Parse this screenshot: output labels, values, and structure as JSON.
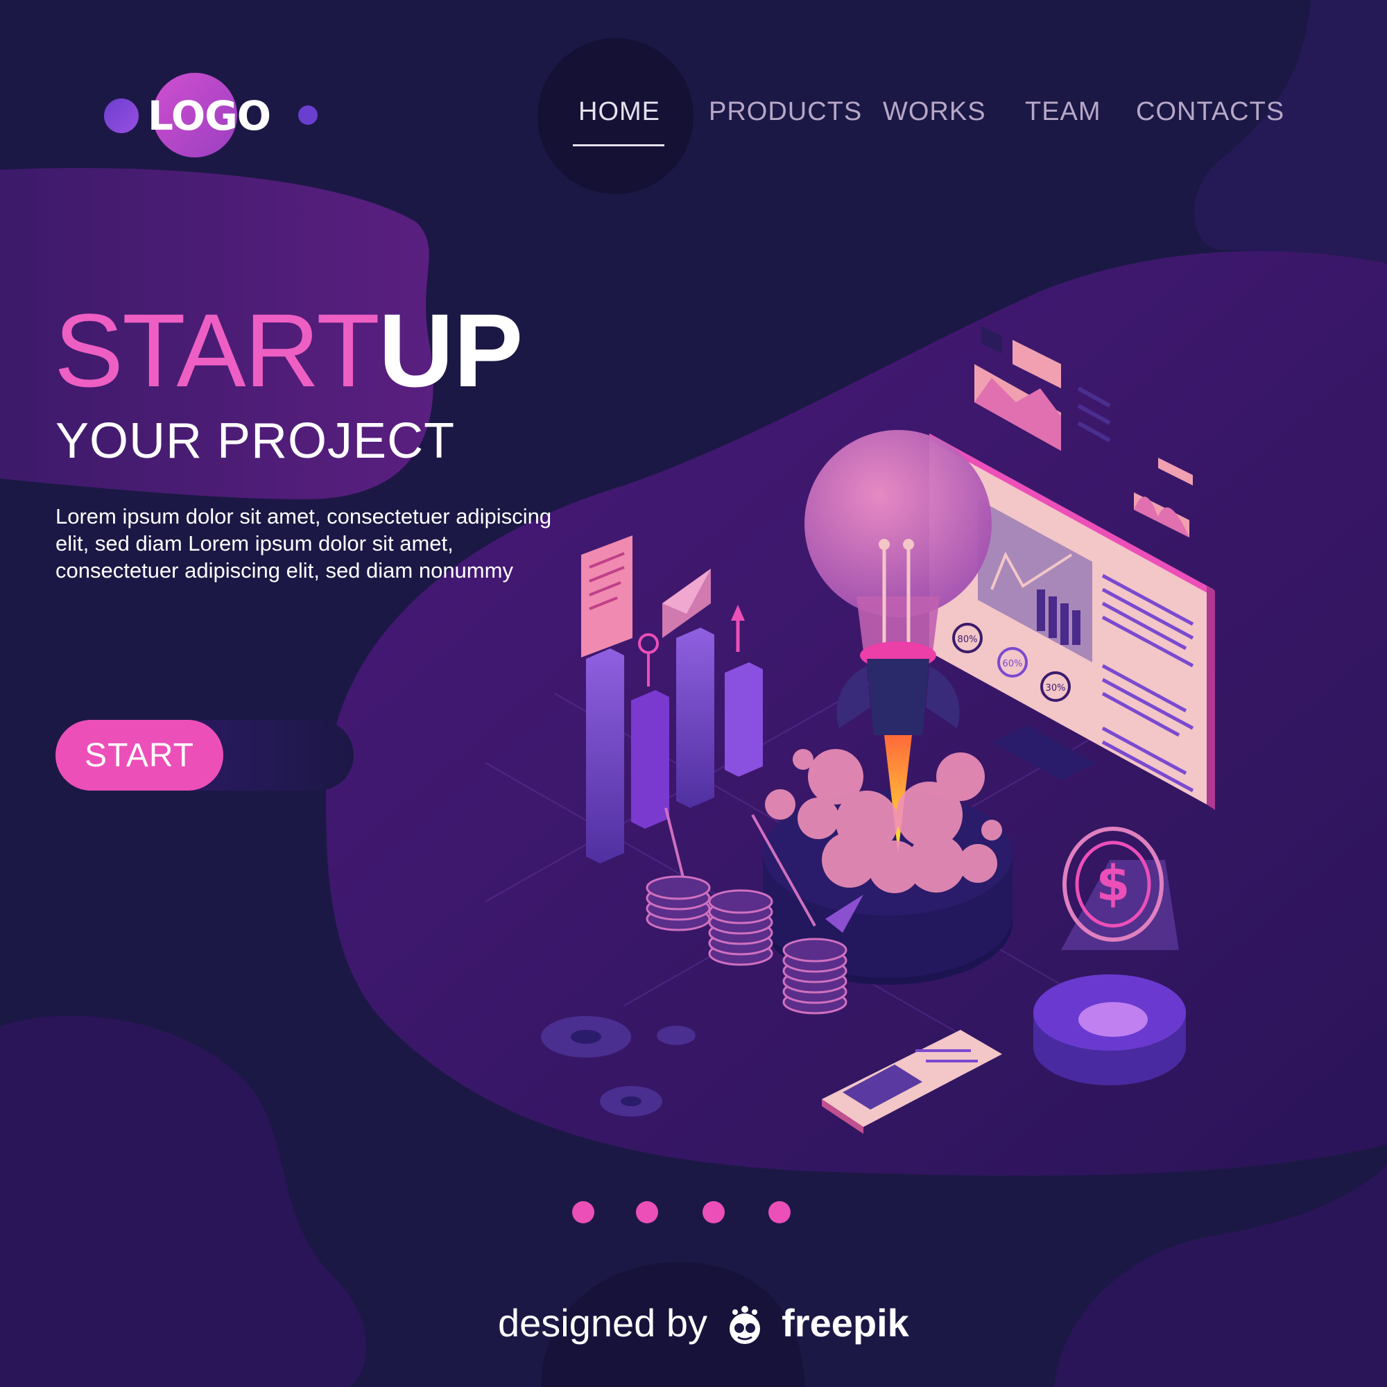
{
  "logo": {
    "text": "LOGO"
  },
  "nav": {
    "items": [
      {
        "label": "HOME",
        "active": true
      },
      {
        "label": "PRODUCTS",
        "active": false
      },
      {
        "label": "WORKS",
        "active": false
      },
      {
        "label": "TEAM",
        "active": false
      },
      {
        "label": "CONTACTS",
        "active": false
      }
    ]
  },
  "hero": {
    "title_part1": "START",
    "title_part2": "UP",
    "subtitle": "YOUR PROJECT",
    "body": "Lorem ipsum dolor sit amet, consectetuer adipiscing elit, sed diam Lorem ipsum dolor sit amet, consectetuer adipiscing elit, sed diam nonummy",
    "cta_label": "START"
  },
  "illustration": {
    "gauges": [
      "80%",
      "60%",
      "30%"
    ],
    "currency_symbol": "$"
  },
  "pagination": {
    "count": 4,
    "color": "#ec4fb8"
  },
  "footer": {
    "credit_prefix": "designed by",
    "credit_brand": "freepik"
  },
  "colors": {
    "background": "#1c1845",
    "accent": "#ec4fb8",
    "purple": "#6a3fd0"
  }
}
